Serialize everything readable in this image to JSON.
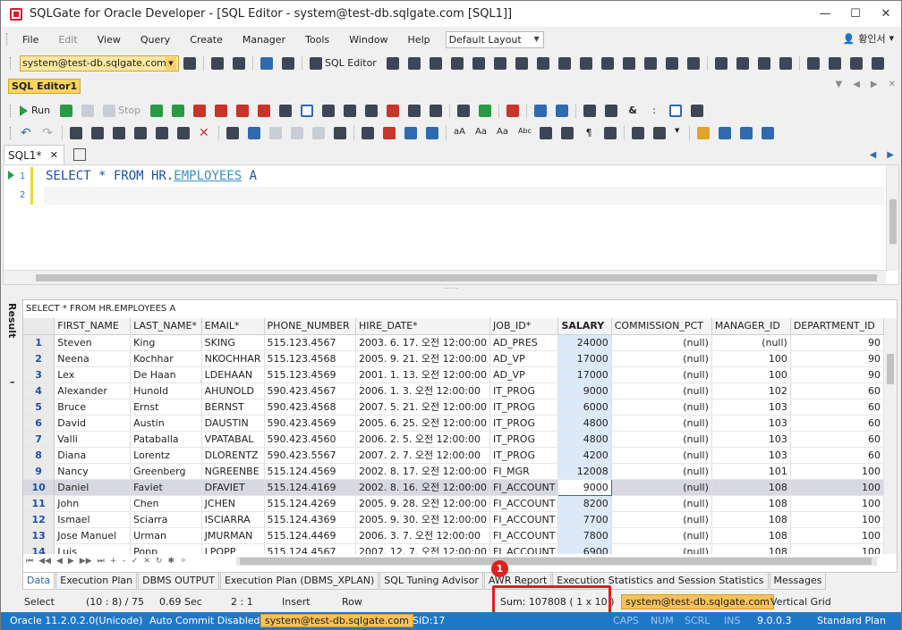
{
  "window": {
    "title": "SQLGate for Oracle Developer - [SQL Editor - system@test-db.sqlgate.com [SQL1]]"
  },
  "menu": {
    "items": [
      "File",
      "Edit",
      "View",
      "Query",
      "Create",
      "Manager",
      "Tools",
      "Window",
      "Help"
    ],
    "layout_value": "Default Layout",
    "user": "황인서"
  },
  "toolbar": {
    "connection": "system@test-db.sqlgate.com",
    "sql_editor_label": "SQL Editor",
    "run_label": "Run",
    "stop_label": "Stop"
  },
  "editor": {
    "tab_label": "SQL Editor1",
    "sql_tab": "SQL1*",
    "line_numbers": [
      "1",
      "2"
    ],
    "sql_keywords": "SELECT * FROM HR.",
    "sql_table": "EMPLOYEES",
    "sql_alias": " A"
  },
  "result": {
    "side_label": "Result",
    "query": "SELECT * FROM HR.EMPLOYEES A",
    "columns": [
      "FIRST_NAME",
      "LAST_NAME*",
      "EMAIL*",
      "PHONE_NUMBER",
      "HIRE_DATE*",
      "JOB_ID*",
      "SALARY",
      "COMMISSION_PCT",
      "MANAGER_ID",
      "DEPARTMENT_ID"
    ],
    "rows": [
      [
        "1",
        "Steven",
        "King",
        "SKING",
        "515.123.4567",
        "2003. 6. 17. 오전 12:00:00",
        "AD_PRES",
        "24000",
        "(null)",
        "(null)",
        "90"
      ],
      [
        "2",
        "Neena",
        "Kochhar",
        "NKOCHHAR",
        "515.123.4568",
        "2005. 9. 21. 오전 12:00:00",
        "AD_VP",
        "17000",
        "(null)",
        "100",
        "90"
      ],
      [
        "3",
        "Lex",
        "De Haan",
        "LDEHAAN",
        "515.123.4569",
        "2001. 1. 13. 오전 12:00:00",
        "AD_VP",
        "17000",
        "(null)",
        "100",
        "90"
      ],
      [
        "4",
        "Alexander",
        "Hunold",
        "AHUNOLD",
        "590.423.4567",
        "2006. 1. 3. 오전 12:00:00",
        "IT_PROG",
        "9000",
        "(null)",
        "102",
        "60"
      ],
      [
        "5",
        "Bruce",
        "Ernst",
        "BERNST",
        "590.423.4568",
        "2007. 5. 21. 오전 12:00:00",
        "IT_PROG",
        "6000",
        "(null)",
        "103",
        "60"
      ],
      [
        "6",
        "David",
        "Austin",
        "DAUSTIN",
        "590.423.4569",
        "2005. 6. 25. 오전 12:00:00",
        "IT_PROG",
        "4800",
        "(null)",
        "103",
        "60"
      ],
      [
        "7",
        "Valli",
        "Pataballa",
        "VPATABAL",
        "590.423.4560",
        "2006. 2. 5. 오전 12:00:00",
        "IT_PROG",
        "4800",
        "(null)",
        "103",
        "60"
      ],
      [
        "8",
        "Diana",
        "Lorentz",
        "DLORENTZ",
        "590.423.5567",
        "2007. 2. 7. 오전 12:00:00",
        "IT_PROG",
        "4200",
        "(null)",
        "103",
        "60"
      ],
      [
        "9",
        "Nancy",
        "Greenberg",
        "NGREENBE",
        "515.124.4569",
        "2002. 8. 17. 오전 12:00:00",
        "FI_MGR",
        "12008",
        "(null)",
        "101",
        "100"
      ],
      [
        "10",
        "Daniel",
        "Faviet",
        "DFAVIET",
        "515.124.4169",
        "2002. 8. 16. 오전 12:00:00",
        "FI_ACCOUNT",
        "9000",
        "(null)",
        "108",
        "100"
      ],
      [
        "11",
        "John",
        "Chen",
        "JCHEN",
        "515.124.4269",
        "2005. 9. 28. 오전 12:00:00",
        "FI_ACCOUNT",
        "8200",
        "(null)",
        "108",
        "100"
      ],
      [
        "12",
        "Ismael",
        "Sciarra",
        "ISCIARRA",
        "515.124.4369",
        "2005. 9. 30. 오전 12:00:00",
        "FI_ACCOUNT",
        "7700",
        "(null)",
        "108",
        "100"
      ],
      [
        "13",
        "Jose Manuel",
        "Urman",
        "JMURMAN",
        "515.124.4469",
        "2006. 3. 7. 오전 12:00:00",
        "FI_ACCOUNT",
        "7800",
        "(null)",
        "108",
        "100"
      ],
      [
        "14",
        "Luis",
        "Popp",
        "LPOPP",
        "515.124.4567",
        "2007. 12. 7. 오전 12:00:00",
        "FI_ACCOUNT",
        "6900",
        "(null)",
        "108",
        "100"
      ]
    ],
    "selected_row": 9
  },
  "bottom_tabs": [
    "Data",
    "Execution Plan",
    "DBMS OUTPUT",
    "Execution Plan (DBMS_XPLAN)",
    "SQL Tuning Advisor",
    "AWR Report",
    "Execution Statistics and Session Statistics",
    "Messages"
  ],
  "status_row": {
    "mode": "Select",
    "position": "(10 : 8) / 75",
    "time": "0.69 Sec",
    "ratio": "2 : 1",
    "insert": "Insert",
    "row": "Row",
    "sum": "Sum: 107808 ( 1 x 10 )",
    "connection": "system@test-db.sqlgate.com",
    "grid": "Vertical Grid"
  },
  "marker": "1",
  "status_bar": {
    "version": "Oracle 11.2.0.2.0(Unicode)",
    "autocommit": "Auto Commit Disabled",
    "connection": "system@test-db.sqlgate.com",
    "sid": "SID:17",
    "caps": "CAPS",
    "num": "NUM",
    "scrl": "SCRL",
    "ins": "INS",
    "build": "9.0.0.3",
    "plan": "Standard Plan"
  },
  "colors": {
    "accent_blue": "#1e78c8",
    "highlight_red": "#e01e1e",
    "connection_yellow": "#fce7a1"
  }
}
